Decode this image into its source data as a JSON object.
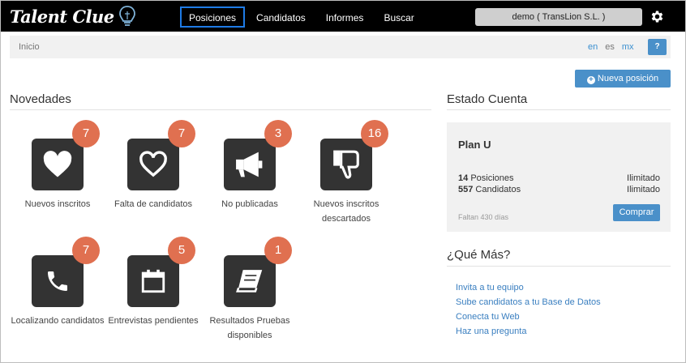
{
  "app": {
    "logo_text": "Talent Clue"
  },
  "nav": {
    "items": [
      {
        "label": "Posiciones",
        "active": true
      },
      {
        "label": "Candidatos",
        "active": false
      },
      {
        "label": "Informes",
        "active": false
      },
      {
        "label": "Buscar",
        "active": false
      }
    ]
  },
  "user": {
    "label": "demo ( TransLion S.L. )"
  },
  "breadcrumb": {
    "home": "Inicio"
  },
  "languages": [
    "en",
    "es",
    "mx"
  ],
  "help": {
    "label": "?"
  },
  "actions": {
    "new_position": "Nueva posición"
  },
  "novedades": {
    "title": "Novedades",
    "tiles": [
      {
        "icon": "heart-filled-icon",
        "count": "7",
        "label": "Nuevos inscritos"
      },
      {
        "icon": "heart-outline-icon",
        "count": "7",
        "label": "Falta de candidatos"
      },
      {
        "icon": "megaphone-icon",
        "count": "3",
        "label": "No publicadas"
      },
      {
        "icon": "thumbs-down-icon",
        "count": "16",
        "label": "Nuevos inscritos descartados"
      },
      {
        "icon": "phone-icon",
        "count": "7",
        "label": "Localizando candidatos"
      },
      {
        "icon": "calendar-icon",
        "count": "5",
        "label": "Entrevistas pendientes"
      },
      {
        "icon": "book-icon",
        "count": "1",
        "label": "Resultados Pruebas disponibles"
      }
    ]
  },
  "estado": {
    "title": "Estado Cuenta",
    "plan": "Plan U",
    "rows": [
      {
        "count": "14",
        "label": "Posiciones",
        "limit": "Ilimitado"
      },
      {
        "count": "557",
        "label": "Candidatos",
        "limit": "Ilimitado"
      }
    ],
    "remaining": "Faltan 430 días",
    "buy_label": "Comprar"
  },
  "que_mas": {
    "title": "¿Qué Más?",
    "links": [
      "Invita a tu equipo",
      "Sube candidatos a tu Base de Datos",
      "Conecta tu Web",
      "Haz una pregunta"
    ]
  },
  "colors": {
    "topbar": "#000000",
    "accent": "#4a90c9",
    "badge": "#e07050",
    "tile": "#333333"
  }
}
